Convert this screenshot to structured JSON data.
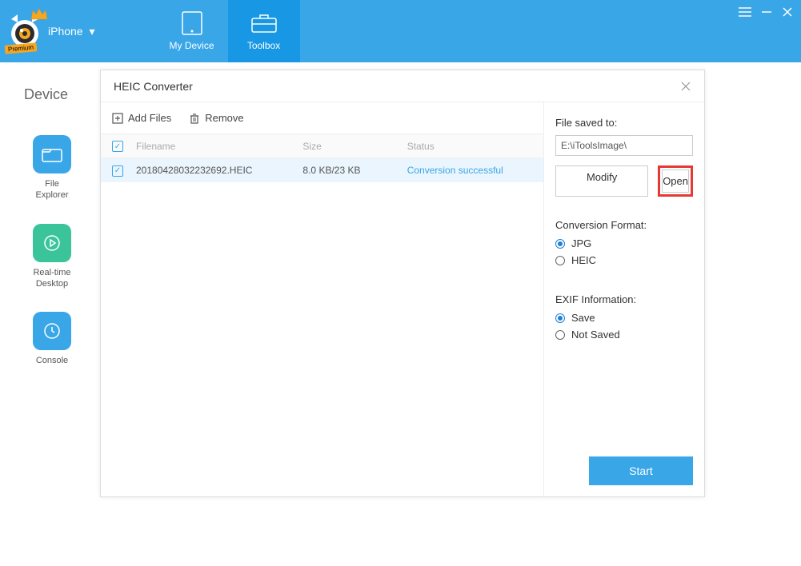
{
  "header": {
    "device_label": "iPhone",
    "premium_badge": "Premium",
    "tabs": {
      "my_device": "My Device",
      "toolbox": "Toolbox"
    }
  },
  "background": {
    "section_title": "Device",
    "tiles": {
      "file_explorer": "File\nExplorer",
      "realtime_desktop": "Real-time\nDesktop",
      "console": "Console"
    }
  },
  "modal": {
    "title": "HEIC Converter",
    "toolbar": {
      "add_files": "Add Files",
      "remove": "Remove"
    },
    "columns": {
      "filename": "Filename",
      "size": "Size",
      "status": "Status"
    },
    "rows": [
      {
        "filename": "20180428032232692.HEIC",
        "size": "8.0 KB/23 KB",
        "status": "Conversion successful",
        "checked": true
      }
    ],
    "sidebar": {
      "saved_to_label": "File saved to:",
      "saved_to_value": "E:\\iToolsImage\\",
      "modify": "Modify",
      "open": "Open",
      "format_label": "Conversion Format:",
      "format_options": {
        "jpg": "JPG",
        "heic": "HEIC"
      },
      "format_selected": "jpg",
      "exif_label": "EXIF Information:",
      "exif_options": {
        "save": "Save",
        "not_saved": "Not Saved"
      },
      "exif_selected": "save",
      "start": "Start"
    }
  }
}
